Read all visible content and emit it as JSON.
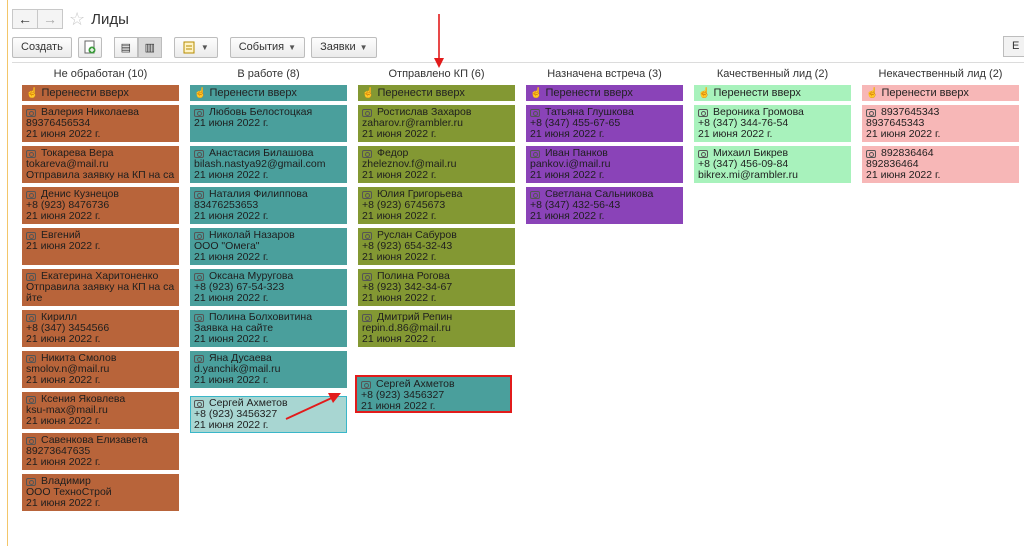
{
  "window": {
    "title": "Лиды"
  },
  "toolbar": {
    "create_label": "Создать",
    "events_label": "События",
    "requests_label": "Заявки",
    "right_label": "Е"
  },
  "move_up_label": "Перенести вверх",
  "colors": {
    "col1": "#b8643a",
    "col2": "#4a9f9c",
    "col3": "#839833",
    "col4": "#8a43b8",
    "col5": "#a8f2bc",
    "col6": "#f7b7b7",
    "ghost": "#a8d6d2",
    "accent_red": "#e21b1b"
  },
  "columns": [
    {
      "title": "Не обработан (10)",
      "cards": [
        {
          "name": "Валерия Николаева",
          "line2": "89376456534",
          "line3": "21 июня 2022 г."
        },
        {
          "name": "Токарева Вера",
          "line2": "tokareva@mail.ru",
          "line3": "Отправила заявку на КП на са"
        },
        {
          "name": "Денис Кузнецов",
          "line2": "+8 (923) 8476736",
          "line3": "21 июня 2022 г."
        },
        {
          "name": "Евгений",
          "line2": "21 июня 2022 г.",
          "line3": ""
        },
        {
          "name": "Екатерина Харитоненко",
          "line2": "Отправила заявку на КП на са",
          "line3": "йте"
        },
        {
          "name": "Кирилл",
          "line2": "+8 (347) 3454566",
          "line3": "21 июня 2022 г."
        },
        {
          "name": "Никита Смолов",
          "line2": "smolov.n@mail.ru",
          "line3": "21 июня 2022 г."
        },
        {
          "name": "Ксения Яковлева",
          "line2": "ksu-max@mail.ru",
          "line3": "21 июня 2022 г."
        },
        {
          "name": "Савенкова Елизавета",
          "line2": "89273647635",
          "line3": "21 июня 2022 г."
        },
        {
          "name": "Владимир",
          "line2": "ООО ТехноСтрой",
          "line3": "21 июня 2022 г."
        }
      ]
    },
    {
      "title": "В работе (8)",
      "cards": [
        {
          "name": "Любовь Белостоцкая",
          "line2": "21 июня 2022 г.",
          "line3": ""
        },
        {
          "name": "Анастасия Билашова",
          "line2": "bilash.nastya92@gmail.com",
          "line3": "21 июня 2022 г."
        },
        {
          "name": "Наталия Филиппова",
          "line2": "83476253653",
          "line3": "21 июня 2022 г."
        },
        {
          "name": "Николай Назаров",
          "line2": "ООО \"Омега\"",
          "line3": "21 июня 2022 г."
        },
        {
          "name": "Оксана Муругова",
          "line2": "+8 (923) 67-54-323",
          "line3": "21 июня 2022 г."
        },
        {
          "name": "Полина Болховитина",
          "line2": "Заявка на сайте",
          "line3": "21 июня 2022 г."
        },
        {
          "name": "Яна Дусаева",
          "line2": "d.yanchik@mail.ru",
          "line3": "21 июня 2022 г."
        },
        {
          "name": "Сергей Ахметов",
          "line2": "+8 (923) 3456327",
          "line3": "21 июня 2022 г."
        }
      ]
    },
    {
      "title": "Отправлено КП (6)",
      "cards": [
        {
          "name": "Ростислав Захаров",
          "line2": "zaharov.r@rambler.ru",
          "line3": "21 июня 2022 г."
        },
        {
          "name": "Федор",
          "line2": "zheleznov.f@mail.ru",
          "line3": "21 июня 2022 г."
        },
        {
          "name": "Юлия Григорьева",
          "line2": "+8 (923) 6745673",
          "line3": "21 июня 2022 г."
        },
        {
          "name": "Руслан Сабуров",
          "line2": "+8 (923) 654-32-43",
          "line3": "21 июня 2022 г."
        },
        {
          "name": "Полина Рогова",
          "line2": "+8 (923) 342-34-67",
          "line3": "21 июня 2022 г."
        },
        {
          "name": "Дмитрий Репин",
          "line2": "repin.d.86@mail.ru",
          "line3": "21 июня 2022 г."
        }
      ]
    },
    {
      "title": "Назначена встреча (3)",
      "cards": [
        {
          "name": "Татьяна Глушкова",
          "line2": "+8 (347) 455-67-65",
          "line3": "21 июня 2022 г."
        },
        {
          "name": "Иван Панков",
          "line2": "pankov.i@mail.ru",
          "line3": "21 июня 2022 г."
        },
        {
          "name": "Светлана Сальникова",
          "line2": "+8 (347) 432-56-43",
          "line3": "21 июня 2022 г."
        }
      ]
    },
    {
      "title": "Качественный лид (2)",
      "cards": [
        {
          "name": "Вероника Громова",
          "line2": "+8 (347) 344-76-54",
          "line3": "21 июня 2022 г."
        },
        {
          "name": "Михаил Бикрев",
          "line2": "+8 (347) 456-09-84",
          "line3": "bikrex.mi@rambler.ru"
        }
      ]
    },
    {
      "title": "Некачественный лид (2)",
      "cards": [
        {
          "name": "8937645343",
          "line2": "8937645343",
          "line3": "21 июня 2022 г."
        },
        {
          "name": "892836464",
          "line2": "892836464",
          "line3": "21 июня 2022 г."
        }
      ]
    }
  ],
  "drag_card": {
    "name": "Сергей Ахметов",
    "line2": "+8 (923) 3456327",
    "line3": "21 июня 2022 г."
  }
}
